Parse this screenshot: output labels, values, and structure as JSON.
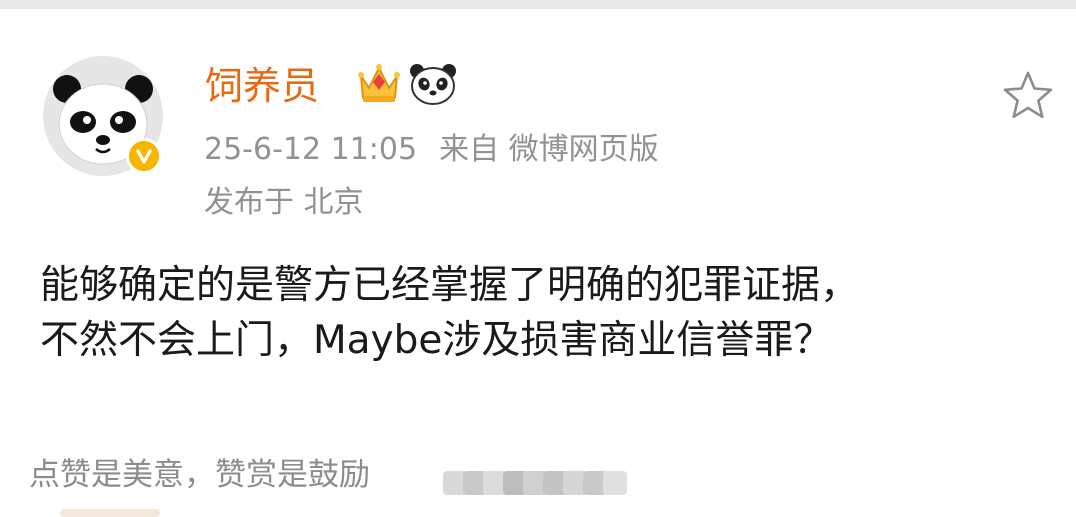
{
  "post": {
    "author": {
      "name": "饲养员"
    },
    "time": "25-6-12 11:05",
    "source": "来自 微博网页版",
    "location": "发布于 北京",
    "content_lines": [
      "能够确定的是警方已经掌握了明确的犯罪证据，",
      "不然不会上门，Maybe涉及损害商业信誉罪？"
    ]
  },
  "footer": {
    "reward_text": "点赞是美意，赞赏是鼓励"
  },
  "colors": {
    "username": "#e96813",
    "meta_text": "#929292",
    "body_text": "#1a1a1a",
    "verified_badge": "#f7b500",
    "top_strip": "#e9e9e9"
  },
  "icons": {
    "avatar": "panda-avatar",
    "verified": "verified-v-badge",
    "vip": "crown-icon",
    "emoji": "panda-emoji-icon",
    "favorite": "star-outline-icon"
  }
}
